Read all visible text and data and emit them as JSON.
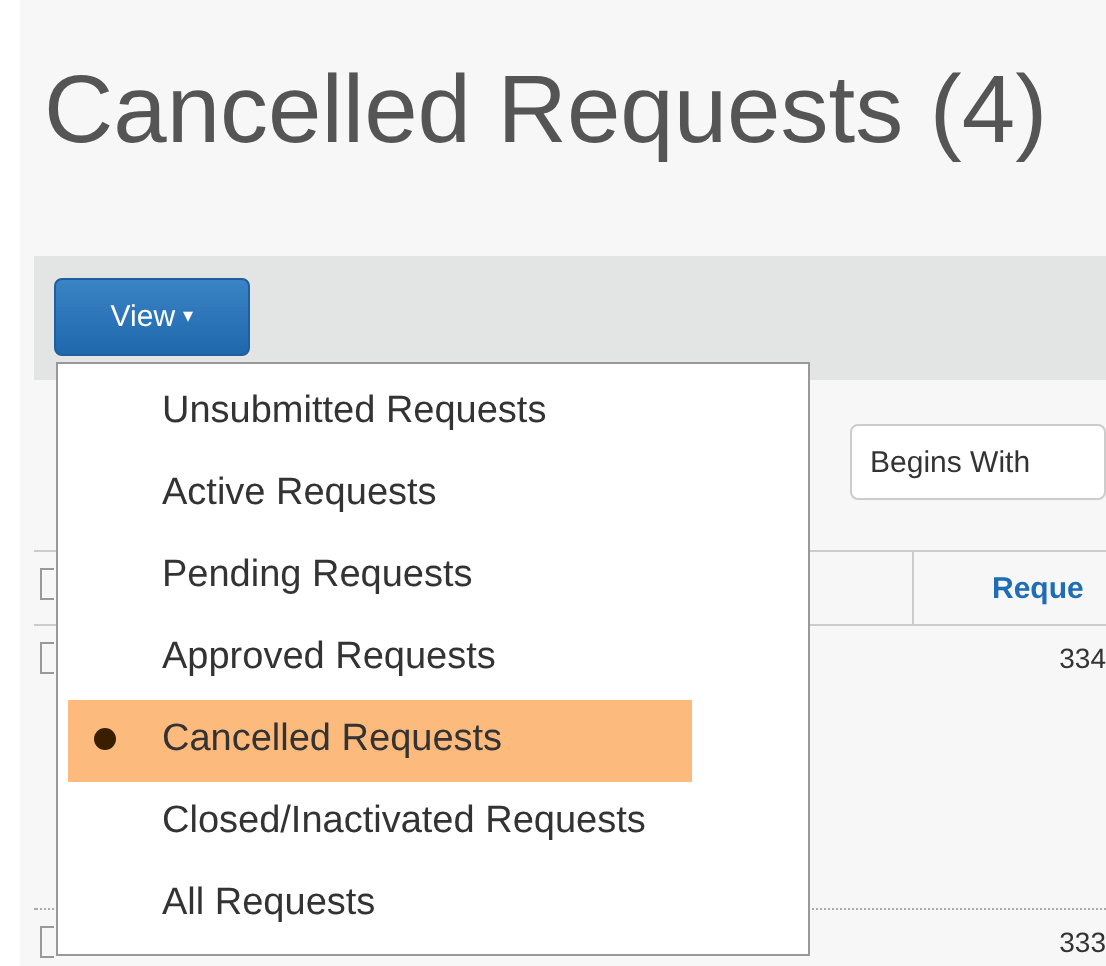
{
  "page_title": "Cancelled Requests (4)",
  "toolbar": {
    "view_button": {
      "label": "View",
      "caret": "▾"
    }
  },
  "filter": {
    "match_select": {
      "value": "Begins With"
    }
  },
  "table": {
    "select_all_checked": false,
    "columns": [
      {
        "label": "Reque"
      }
    ],
    "rows": [
      {
        "checked": false,
        "column_1": "334"
      },
      {
        "checked": false,
        "column_1": "333"
      }
    ]
  },
  "view_menu": {
    "items": [
      {
        "label": "Unsubmitted Requests",
        "selected": false
      },
      {
        "label": "Active Requests",
        "selected": false
      },
      {
        "label": "Pending Requests",
        "selected": false
      },
      {
        "label": "Approved Requests",
        "selected": false
      },
      {
        "label": "Cancelled Requests",
        "selected": true
      },
      {
        "label": "Closed/Inactivated Requests",
        "selected": false
      },
      {
        "label": "All Requests",
        "selected": false
      }
    ]
  }
}
